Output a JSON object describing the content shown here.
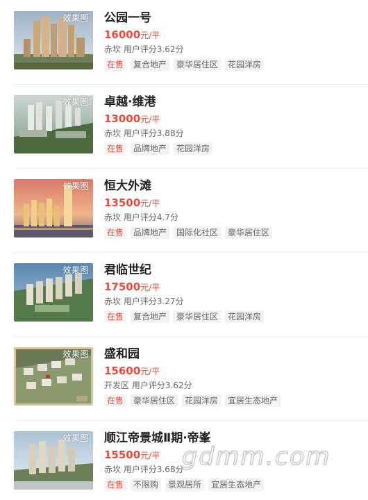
{
  "listings": [
    {
      "name": "公园一号",
      "price": "16000",
      "unit": "元/平",
      "district": "赤坎",
      "rating_label": "用户评分",
      "rating": "3.62分",
      "badge": "效果图",
      "tags": [
        "在售",
        "复合地产",
        "豪华居住区",
        "花园洋房"
      ]
    },
    {
      "name": "卓越·维港",
      "price": "13000",
      "unit": "元/平",
      "district": "赤坎",
      "rating_label": "用户评分",
      "rating": "3.88分",
      "badge": "效果图",
      "tags": [
        "在售",
        "品牌地产",
        "花园洋房"
      ]
    },
    {
      "name": "恒大外滩",
      "price": "13500",
      "unit": "元/平",
      "district": "赤坎",
      "rating_label": "用户评分",
      "rating": "4.7分",
      "badge": "效果图",
      "tags": [
        "在售",
        "品牌地产",
        "国际化社区",
        "豪华居住区"
      ]
    },
    {
      "name": "君临世纪",
      "price": "17500",
      "unit": "元/平",
      "district": "赤坎",
      "rating_label": "用户评分",
      "rating": "3.27分",
      "badge": "效果图",
      "tags": [
        "在售",
        "复合地产",
        "豪华居住区",
        "花园洋房"
      ]
    },
    {
      "name": "盛和园",
      "price": "15600",
      "unit": "元/平",
      "district": "开发区",
      "rating_label": "用户评分",
      "rating": "3.62分",
      "badge": "效果图",
      "tags": [
        "在售",
        "豪华居住区",
        "花园洋房",
        "宜居生态地产"
      ]
    },
    {
      "name": "顺江帝景城Ⅱ期·帝峯",
      "price": "15500",
      "unit": "元/平",
      "district": "赤坎",
      "rating_label": "用户评分",
      "rating": "3.68分",
      "badge": "效果图",
      "tags": [
        "在售",
        "不限购",
        "景观居所",
        "宜居生态地产"
      ]
    }
  ],
  "watermark": "gdmm.com",
  "colors": {
    "price": "#e94b3c",
    "hot_tag": "#e94b3c",
    "tag_bg": "#f3f3f3",
    "text_secondary": "#666666"
  }
}
